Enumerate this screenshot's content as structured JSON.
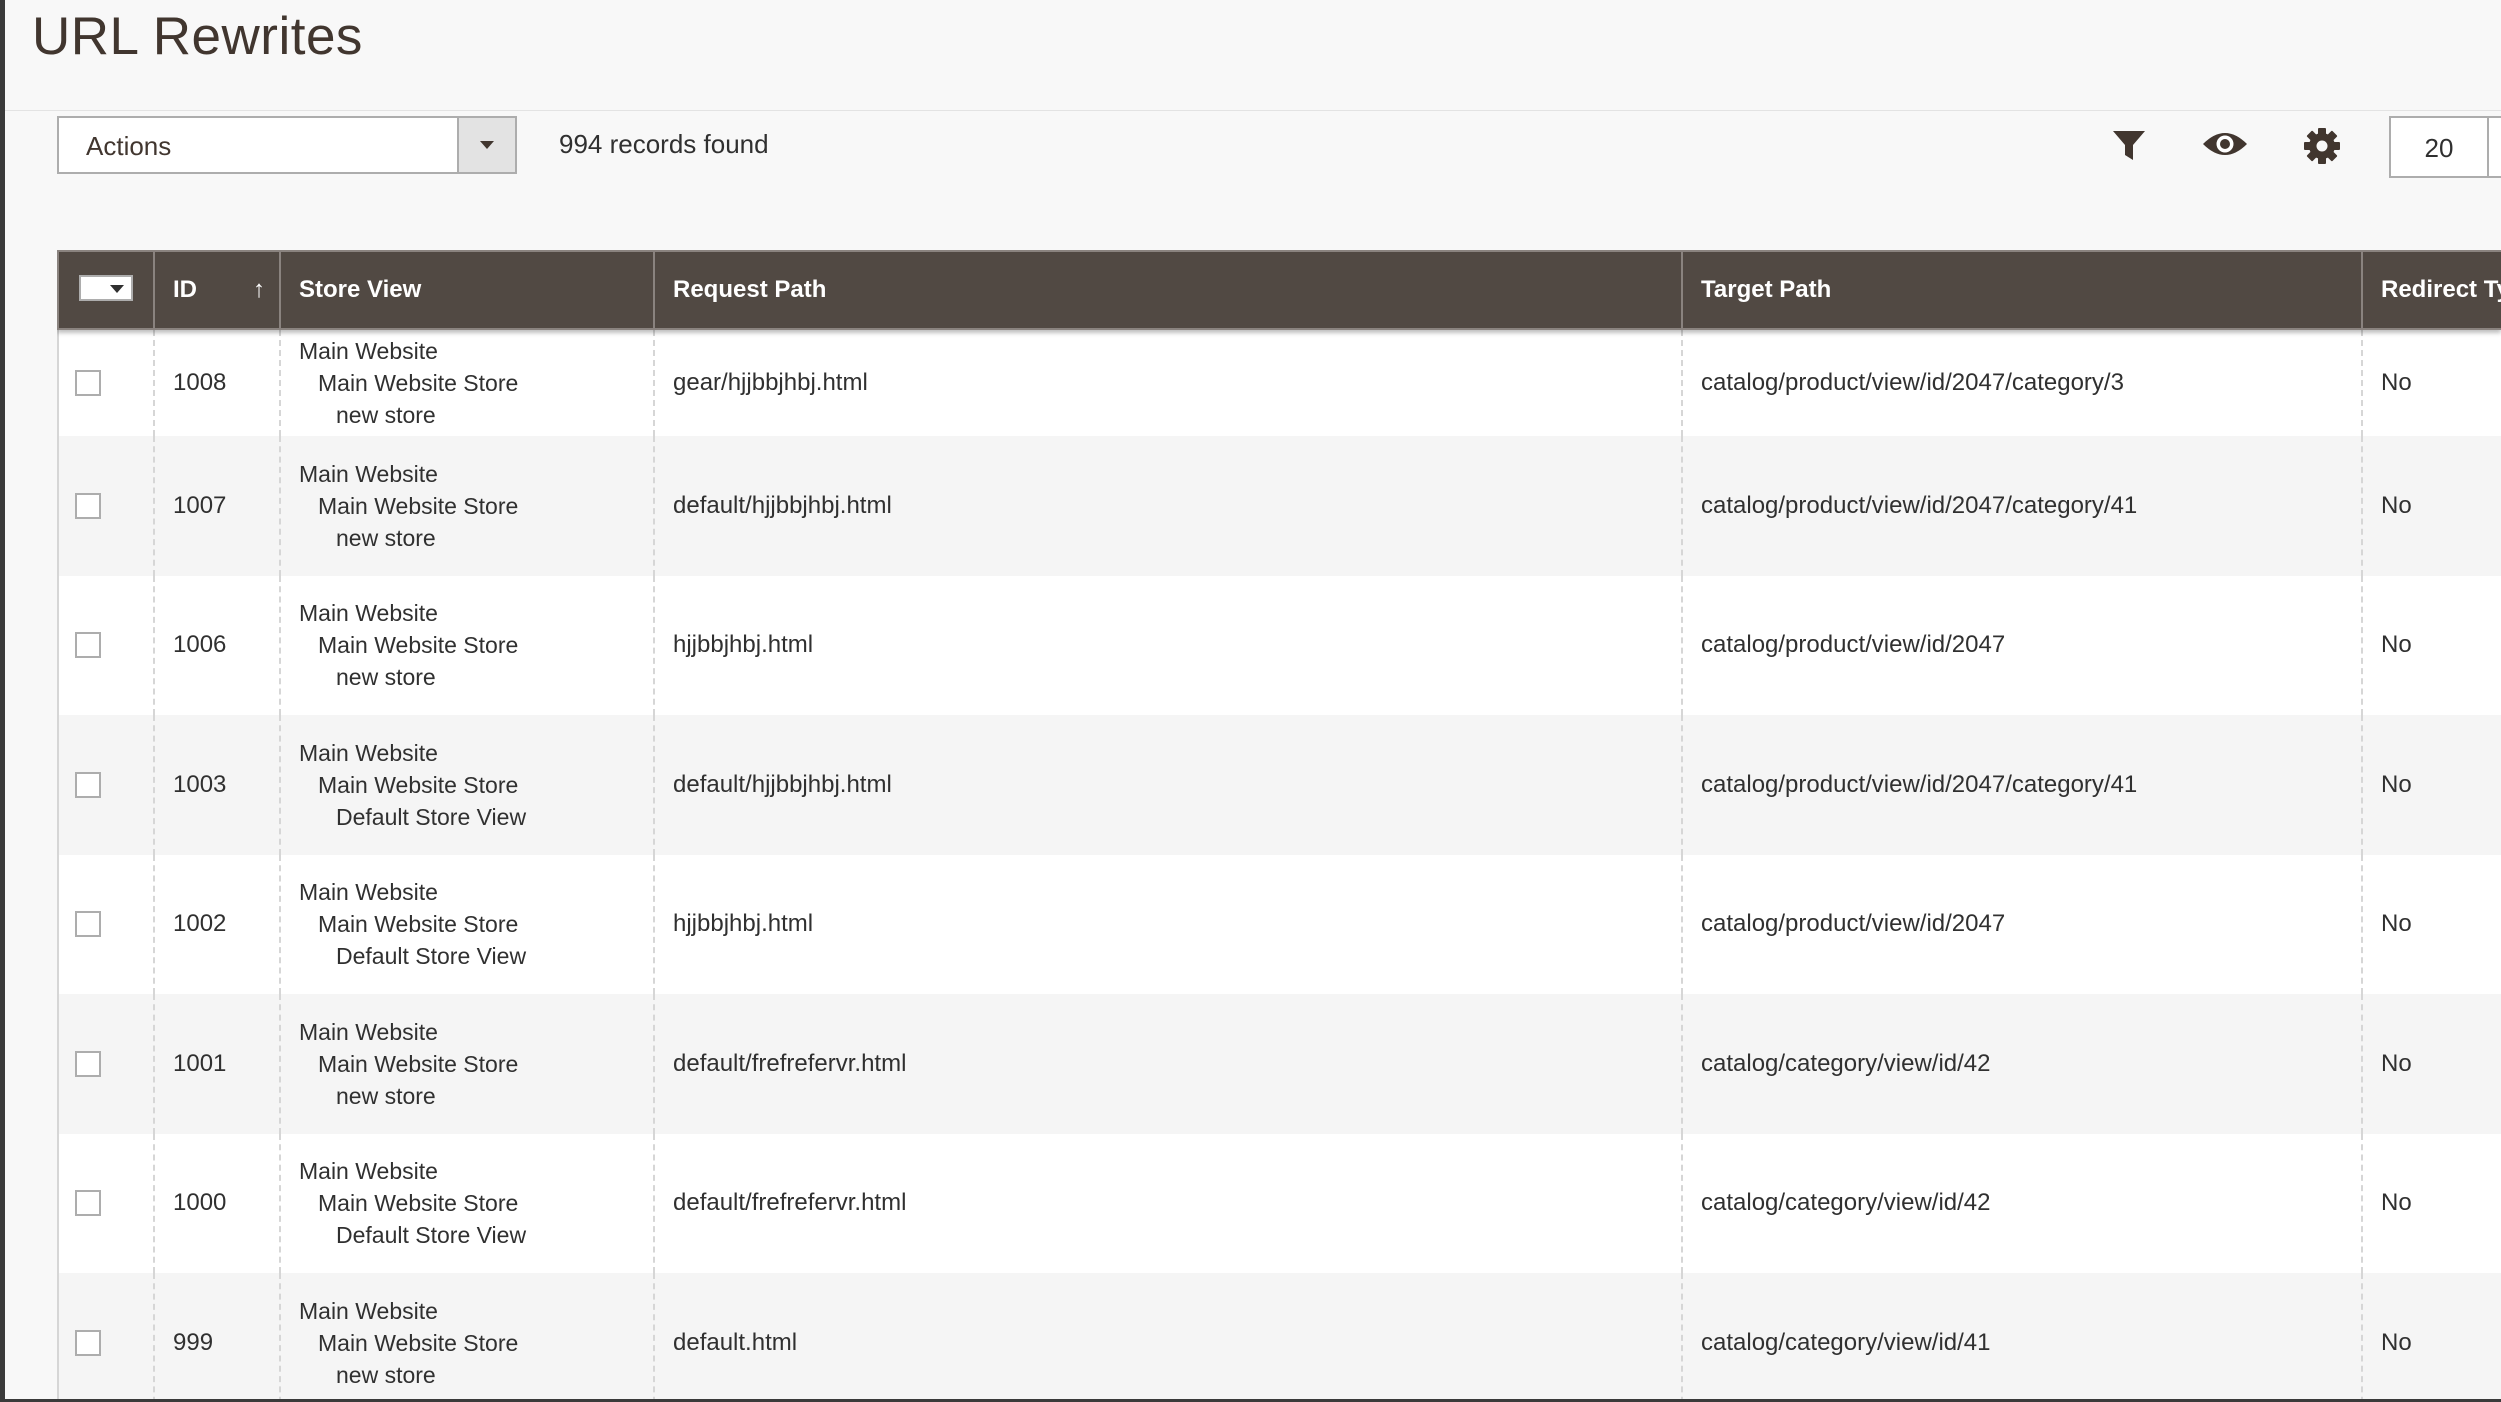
{
  "page": {
    "title": "URL Rewrites"
  },
  "toolbar": {
    "actions_label": "Actions",
    "records_found": "994 records found",
    "per_page_value": "20",
    "icons": [
      "filter-icon",
      "eye-icon",
      "gear-icon"
    ]
  },
  "grid": {
    "columns": [
      "ID",
      "Store View",
      "Request Path",
      "Target Path",
      "Redirect Ty"
    ],
    "sort_indicator": "↑",
    "rows": [
      {
        "id": "1008",
        "store": [
          "Main Website",
          "Main Website Store",
          "new store"
        ],
        "request_path": "gear/hjjbbjhbj.html",
        "target_path": "catalog/product/view/id/2047/category/3",
        "redirect": "No"
      },
      {
        "id": "1007",
        "store": [
          "Main Website",
          "Main Website Store",
          "new store"
        ],
        "request_path": "default/hjjbbjhbj.html",
        "target_path": "catalog/product/view/id/2047/category/41",
        "redirect": "No"
      },
      {
        "id": "1006",
        "store": [
          "Main Website",
          "Main Website Store",
          "new store"
        ],
        "request_path": "hjjbbjhbj.html",
        "target_path": "catalog/product/view/id/2047",
        "redirect": "No"
      },
      {
        "id": "1003",
        "store": [
          "Main Website",
          "Main Website Store",
          "Default Store View"
        ],
        "request_path": "default/hjjbbjhbj.html",
        "target_path": "catalog/product/view/id/2047/category/41",
        "redirect": "No"
      },
      {
        "id": "1002",
        "store": [
          "Main Website",
          "Main Website Store",
          "Default Store View"
        ],
        "request_path": "hjjbbjhbj.html",
        "target_path": "catalog/product/view/id/2047",
        "redirect": "No"
      },
      {
        "id": "1001",
        "store": [
          "Main Website",
          "Main Website Store",
          "new store"
        ],
        "request_path": "default/frefrefervr.html",
        "target_path": "catalog/category/view/id/42",
        "redirect": "No"
      },
      {
        "id": "1000",
        "store": [
          "Main Website",
          "Main Website Store",
          "Default Store View"
        ],
        "request_path": "default/frefrefervr.html",
        "target_path": "catalog/category/view/id/42",
        "redirect": "No"
      },
      {
        "id": "999",
        "store": [
          "Main Website",
          "Main Website Store",
          "new store"
        ],
        "request_path": "default.html",
        "target_path": "catalog/category/view/id/41",
        "redirect": "No"
      }
    ]
  }
}
